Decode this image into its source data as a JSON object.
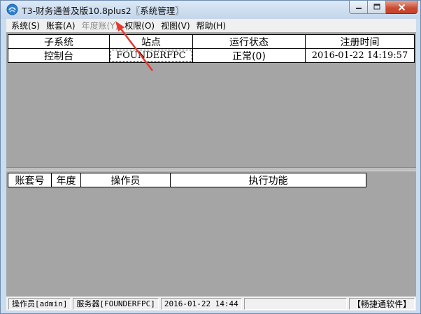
{
  "window": {
    "title": "T3-财务通普及版10.8plus2〖系统管理〗"
  },
  "menu": [
    {
      "label": "系统(S)",
      "enabled": true
    },
    {
      "label": "账套(A)",
      "enabled": true
    },
    {
      "label": "年度账(Y)",
      "enabled": false
    },
    {
      "label": "权限(O)",
      "enabled": true
    },
    {
      "label": "视图(V)",
      "enabled": true
    },
    {
      "label": "帮助(H)",
      "enabled": true
    }
  ],
  "subsystem_table": {
    "headers": [
      "子系统",
      "站点",
      "运行状态",
      "注册时间"
    ],
    "rows": [
      [
        "控制台",
        "FOUNDERFPC",
        "正常(0)",
        "2016-01-22 14:19:57"
      ]
    ]
  },
  "task_table": {
    "headers": [
      "账套号",
      "年度",
      "操作员",
      "执行功能"
    ],
    "rows": []
  },
  "statusbar": {
    "operator": "操作员[admin]",
    "server": "服务器[FOUNDERFPC]",
    "datetime": "2016-01-22 14:44",
    "brand": "【畅捷通软件】"
  },
  "colors": {
    "client_bg": "#a5a5a5",
    "annotation_arrow": "#e8382c",
    "close_button": "#c7432a"
  }
}
